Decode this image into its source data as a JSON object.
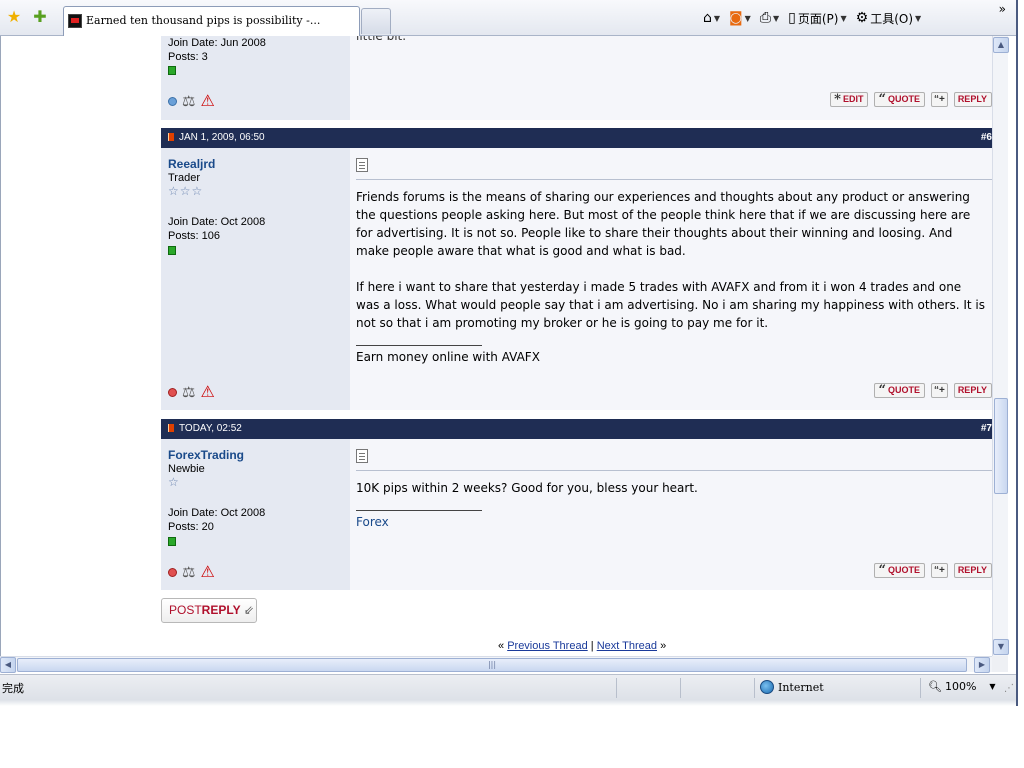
{
  "browser": {
    "tab_title": "Earned ten thousand pips is possibility -...",
    "commands": {
      "home_icon": "home-icon",
      "feeds_icon": "rss-icon",
      "print_icon": "print-icon",
      "page_label": "页面(P)",
      "tools_label": "工具(O)"
    },
    "status_text": "完成",
    "zone_label": "Internet",
    "zoom_label": "100%"
  },
  "posts": [
    {
      "partial": true,
      "join_date": "Join Date: Jun 2008",
      "posts_count": "Posts: 3",
      "status_color": "#6aa0d8",
      "message_tail": "little bit.",
      "buttons": {
        "edit": "EDIT",
        "quote": "QUOTE",
        "reply": "REPLY"
      }
    },
    {
      "date": "JAN 1, 2009, 06:50",
      "number": "#6",
      "username": "Reealjrd",
      "user_title": "Trader",
      "stars": "☆☆☆",
      "join_date": "Join Date: Oct 2008",
      "posts_count": "Posts: 106",
      "paragraph_1": "Friends forums is the means of sharing our experiences and thoughts about any product or answering the questions people asking here. But most of the people think here that if we are discussing here are for advertising. It is not so. People like to share their thoughts about their winning and loosing. And make people aware that what is good and what is bad.",
      "paragraph_2": "If here i want to share that yesterday i made 5 trades with AVAFX and from it i won 4 trades and one was a loss. What would people say that i am advertising. No i am sharing my happiness with others. It is not so that i am promoting my broker or he is going to pay me for it.",
      "signature": "Earn money online with AVAFX",
      "buttons": {
        "quote": "QUOTE",
        "reply": "REPLY"
      }
    },
    {
      "date": "TODAY, 02:52",
      "number": "#7",
      "username": "ForexTrading",
      "user_title": "Newbie",
      "stars": "☆",
      "join_date": "Join Date: Oct 2008",
      "posts_count": "Posts: 20",
      "paragraph_1": "10K pips within 2 weeks? Good for you, bless your heart.",
      "signature": "Forex",
      "buttons": {
        "quote": "QUOTE",
        "reply": "REPLY"
      }
    }
  ],
  "post_reply": {
    "prefix": "POST",
    "bold": "REPLY"
  },
  "thread_nav": {
    "left_quote": "«",
    "previous": "Previous Thread",
    "separator": "|",
    "next": "Next Thread",
    "right_quote": "»"
  },
  "colors": {
    "header_bg": "#1f2d54",
    "username": "#1a4a8a",
    "button_text": "#b0102c",
    "online_green": "#2aa82a"
  }
}
